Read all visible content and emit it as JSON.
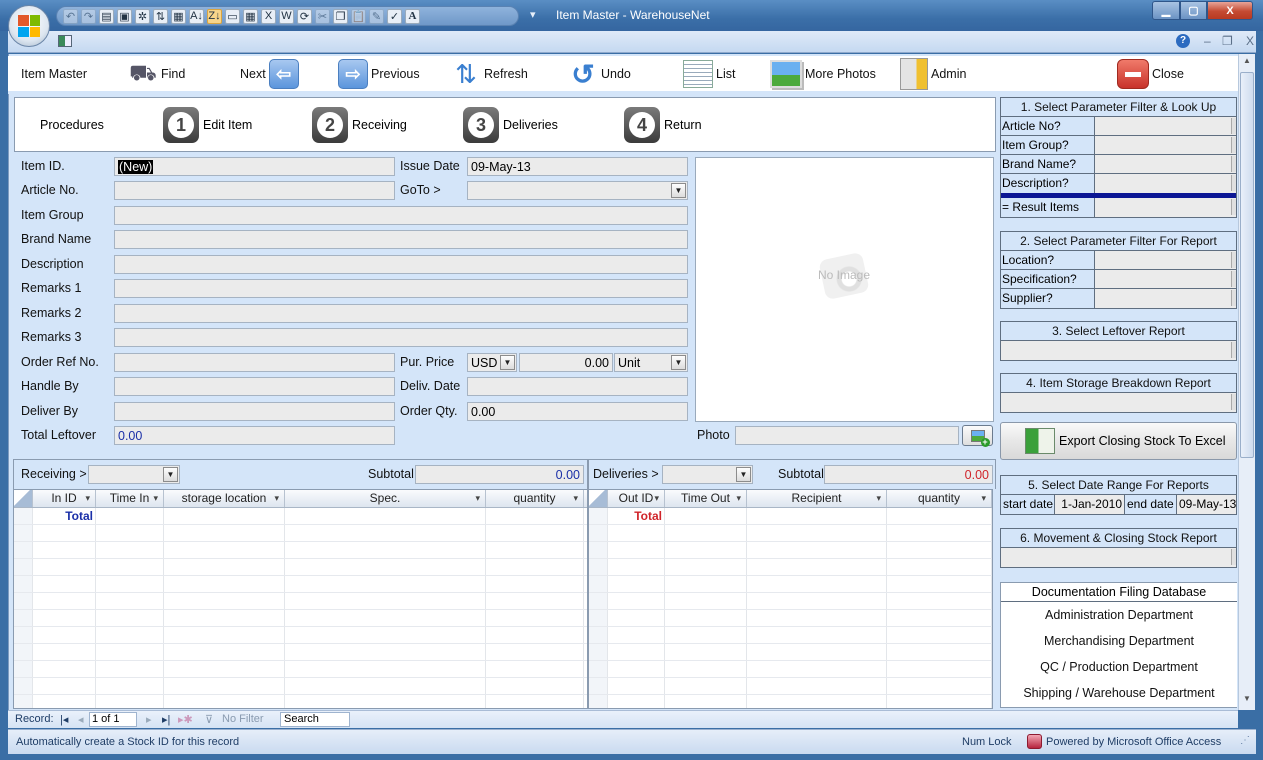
{
  "window": {
    "title": "Item Master - WarehouseNet",
    "qat_icons": [
      "undo-icon",
      "redo-icon",
      "form-view-icon",
      "new-record-icon",
      "filter-icon",
      "sort-icon",
      "advanced-filter-icon",
      "sort-ascending-icon",
      "sort-descending-icon",
      "form-icon",
      "datasheet-icon",
      "export-excel-icon",
      "export-word-icon",
      "refresh-all-icon",
      "cut-icon",
      "copy-icon",
      "paste-icon",
      "format-painter-icon",
      "spelling-icon",
      "font-icon"
    ],
    "doc_controls": {
      "help": "?",
      "minimize": "–",
      "restore": "❐",
      "close": "X"
    }
  },
  "toolbar": {
    "form_title": "Item Master",
    "find": "Find",
    "next": "Next",
    "previous": "Previous",
    "refresh": "Refresh",
    "undo": "Undo",
    "list": "List",
    "more_photos": "More Photos",
    "admin": "Admin",
    "close": "Close"
  },
  "procedures": {
    "label": "Procedures",
    "steps": [
      {
        "num": "1",
        "label": "Edit Item"
      },
      {
        "num": "2",
        "label": "Receiving"
      },
      {
        "num": "3",
        "label": "Deliveries"
      },
      {
        "num": "4",
        "label": "Return"
      }
    ]
  },
  "form": {
    "item_id": {
      "label": "Item ID.",
      "value": "(New)"
    },
    "issue_date": {
      "label": "Issue Date",
      "value": "09-May-13"
    },
    "article_no": {
      "label": "Article No.",
      "value": ""
    },
    "goto": {
      "label": "GoTo >",
      "value": ""
    },
    "item_group": {
      "label": "Item Group",
      "value": ""
    },
    "brand_name": {
      "label": "Brand Name",
      "value": ""
    },
    "description": {
      "label": "Description",
      "value": ""
    },
    "remarks1": {
      "label": "Remarks 1",
      "value": ""
    },
    "remarks2": {
      "label": "Remarks 2",
      "value": ""
    },
    "remarks3": {
      "label": "Remarks 3",
      "value": ""
    },
    "order_ref": {
      "label": "Order Ref No.",
      "value": ""
    },
    "pur_price": {
      "label": "Pur. Price",
      "currency": "USD",
      "value": "0.00",
      "unit": "Unit"
    },
    "handle_by": {
      "label": "Handle By",
      "value": ""
    },
    "deliv_date": {
      "label": "Deliv. Date",
      "value": ""
    },
    "deliver_by": {
      "label": "Deliver By",
      "value": ""
    },
    "order_qty": {
      "label": "Order Qty.",
      "value": "0.00"
    },
    "total_leftover": {
      "label": "Total Leftover",
      "value": "0.00"
    },
    "photo": {
      "label": "Photo",
      "value": "",
      "placeholder": "No Image"
    }
  },
  "right_panel": {
    "lookup": {
      "title": "1. Select Parameter Filter & Look Up",
      "rows": [
        "Article No?",
        "Item Group?",
        "Brand Name?",
        "Description?"
      ],
      "result": "= Result Items"
    },
    "report_filter": {
      "title": "2. Select Parameter Filter For Report",
      "rows": [
        "Location?",
        "Specification?",
        "Supplier?"
      ]
    },
    "leftover": {
      "title": "3. Select Leftover Report"
    },
    "storage": {
      "title": "4. Item Storage Breakdown Report"
    },
    "export": {
      "label": "Export Closing Stock To Excel"
    },
    "date_range": {
      "title": "5. Select Date Range For  Reports",
      "start_label": "start date",
      "start_value": "1-Jan-2010",
      "end_label": "end date",
      "end_value": "09-May-13"
    },
    "movement": {
      "title": "6. Movement & Closing Stock Report"
    },
    "docs": {
      "title": "Documentation Filing Database",
      "items": [
        "Administration Department",
        "Merchandising Department",
        "QC / Production Department",
        "Shipping / Warehouse Department"
      ]
    }
  },
  "receiving": {
    "label": "Receiving >",
    "subtotal_label": "Subtotal",
    "subtotal": "0.00",
    "columns": [
      "In ID",
      "Time In",
      "storage location",
      "Spec.",
      "quantity"
    ],
    "total_label": "Total"
  },
  "deliveries": {
    "label": "Deliveries >",
    "subtotal_label": "Subtotal",
    "subtotal": "0.00",
    "columns": [
      "Out ID",
      "Time Out",
      "Recipient",
      "quantity"
    ],
    "total_label": "Total"
  },
  "navbar": {
    "record_label": "Record:",
    "record_value": "1 of 1",
    "no_filter": "No Filter",
    "search": "Search"
  },
  "status": {
    "message": "Automatically create a Stock ID for this record",
    "num_lock": "Num Lock",
    "powered": "Powered by Microsoft Office Access"
  },
  "colors": {
    "accent_blue": "#1a2fa8",
    "accent_red": "#d0242a",
    "form_bg": "#d4e5f9"
  }
}
